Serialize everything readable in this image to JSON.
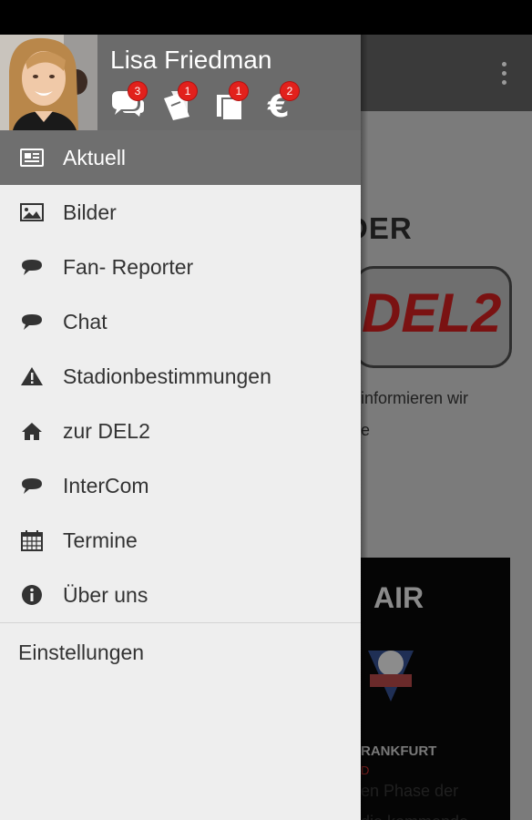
{
  "background": {
    "heading_fragment": "DER",
    "logo_text": "DEL2",
    "text_line1": "informieren wir",
    "text_line2": "e",
    "promo_title": "AIR",
    "promo_city": "RANKFURT",
    "promo_red": "D",
    "bottom_line1": "en Phase der",
    "bottom_line2": "die kommende"
  },
  "drawer": {
    "user_name": "Lisa Friedman",
    "header_icons": [
      {
        "icon": "chat-bubbles-icon",
        "badge": "3"
      },
      {
        "icon": "tickets-icon",
        "badge": "1"
      },
      {
        "icon": "copy-icon",
        "badge": "1"
      },
      {
        "icon": "euro-icon",
        "badge": "2"
      }
    ],
    "items": [
      {
        "label": "Aktuell",
        "icon": "newspaper-icon",
        "selected": true
      },
      {
        "label": "Bilder",
        "icon": "image-icon"
      },
      {
        "label": "Fan- Reporter",
        "icon": "chat-bubble-icon"
      },
      {
        "label": "Chat",
        "icon": "chat-bubble-icon"
      },
      {
        "label": "Stadionbestimmungen",
        "icon": "warning-icon"
      },
      {
        "label": "zur DEL2",
        "icon": "home-icon"
      },
      {
        "label": "InterCom",
        "icon": "chat-bubble-icon"
      },
      {
        "label": "Termine",
        "icon": "calendar-icon"
      },
      {
        "label": "Über uns",
        "icon": "info-icon"
      }
    ],
    "settings_label": "Einstellungen"
  },
  "colors": {
    "drawer_bg": "#eeeeee",
    "header_bg": "#6b6b6b",
    "selected_bg": "#6f6f6f",
    "badge": "#e2211c"
  }
}
